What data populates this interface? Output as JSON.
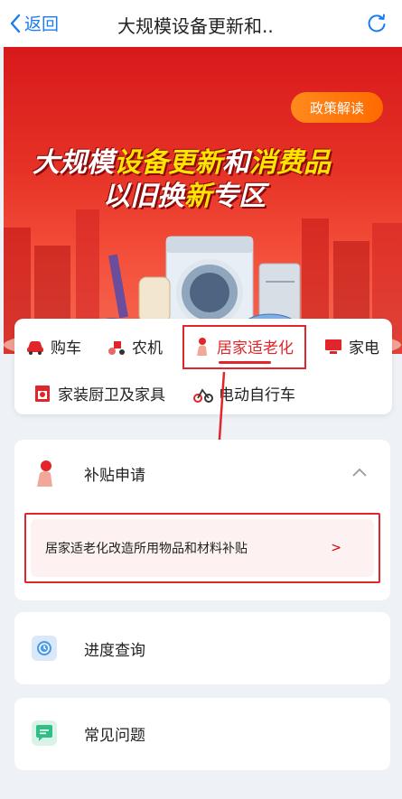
{
  "nav": {
    "back_label": "返回",
    "title": "大规模设备更新和.."
  },
  "banner": {
    "policy_button": "政策解读",
    "headline_1a": "大规模",
    "headline_1b": "设备更新",
    "headline_1c": "和",
    "headline_1d": "消费品",
    "headline_2a": "以旧换",
    "headline_2b": "新",
    "headline_2c": "专区"
  },
  "categories": [
    {
      "label": "购车",
      "icon": "car-icon"
    },
    {
      "label": "农机",
      "icon": "tractor-icon"
    },
    {
      "label": "居家适老化",
      "icon": "elderly-person-icon",
      "active": true
    },
    {
      "label": "家电",
      "icon": "appliance-icon"
    },
    {
      "label": "家装厨卫及家具",
      "icon": "kitchen-icon"
    },
    {
      "label": "电动自行车",
      "icon": "ebike-icon"
    }
  ],
  "subsidy": {
    "title": "补贴申请",
    "item": "居家适老化改造所用物品和材料补贴",
    "item_arrow": ">"
  },
  "progress": {
    "title": "进度查询"
  },
  "faq": {
    "title": "常见问题"
  },
  "colors": {
    "accent_red": "#e0262a",
    "nav_blue": "#1a7cf0",
    "policy_orange": "#ff7a10"
  }
}
